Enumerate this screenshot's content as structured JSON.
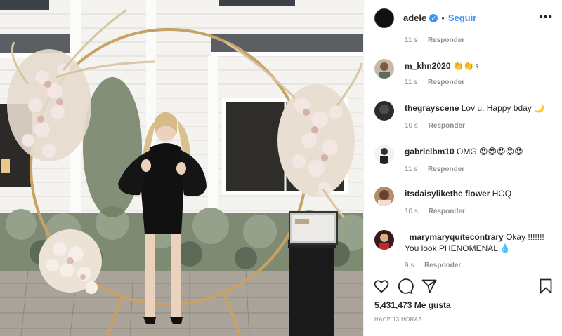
{
  "header": {
    "username": "adele",
    "separator": "•",
    "follow_label": "Seguir",
    "more": "•••"
  },
  "comments": {
    "top_meta_time": "11 s",
    "top_meta_reply": "Responder",
    "items": [
      {
        "username": "m_khn2020",
        "text": "👏👏♀",
        "time": "11 s",
        "reply": "Responder"
      },
      {
        "username": "thegrayscene",
        "text": "Lov u. Happy bday 🌙",
        "time": "10 s",
        "reply": "Responder"
      },
      {
        "username": "gabrielbm10",
        "text": "OMG 😍😍😍😍😍",
        "time": "11 s",
        "reply": "Responder"
      },
      {
        "username": "itsdaisylikethe flower",
        "text": "HOQ",
        "time": "10 s",
        "reply": "Responder"
      },
      {
        "username": "_marymaryquitecontrary",
        "text": "Okay !!!!!!! You look PHENOMENAL 💧",
        "time": "9 s",
        "reply": "Responder"
      }
    ]
  },
  "actions": {
    "likes": "5,431,473 Me gusta",
    "time_ago": "HACE 13 HORAS"
  },
  "icons": {
    "verified": "verified-badge-icon",
    "like": "heart-icon",
    "comment": "comment-bubble-icon",
    "share": "paper-plane-icon",
    "save": "bookmark-icon"
  },
  "colors": {
    "accent": "#3897f0",
    "text": "#262626",
    "muted": "#8e8e8e",
    "border": "#efefef"
  }
}
